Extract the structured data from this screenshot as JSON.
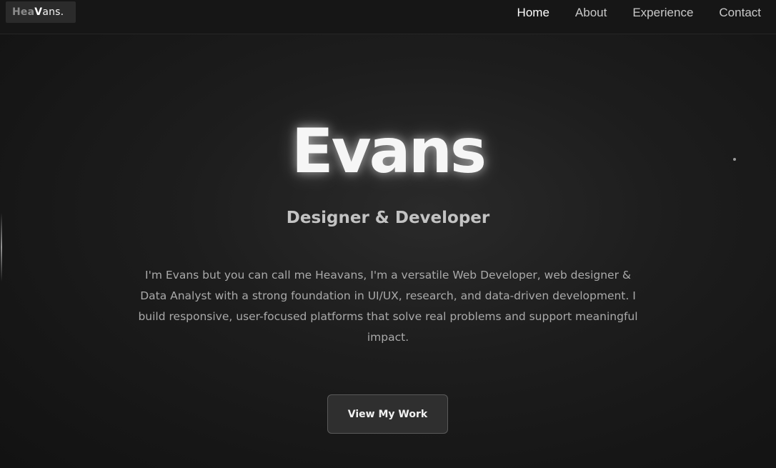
{
  "header": {
    "logo": {
      "prefix": "Hea",
      "mid": "V",
      "suffix": "ans."
    },
    "nav": [
      {
        "label": "Home"
      },
      {
        "label": "About"
      },
      {
        "label": "Experience"
      },
      {
        "label": "Contact"
      }
    ]
  },
  "hero": {
    "title": "Evans",
    "subtitle": "Designer & Developer",
    "description": "I'm Evans but you can call me Heavans, I'm a versatile Web Developer, web designer & Data Analyst with a strong foundation in UI/UX, research, and data-driven development. I build responsive, user-focused platforms that solve real problems and support meaningful impact.",
    "cta_label": "View My Work"
  },
  "colors": {
    "background": "#1d1d1d",
    "nav_active": "#ffffff",
    "nav_inactive": "#c9c9c9",
    "button_bg": "#2f2f2f",
    "button_border": "#5a5a5a"
  }
}
